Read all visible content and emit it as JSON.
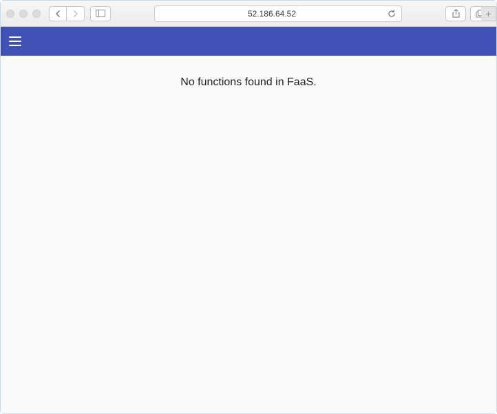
{
  "browser": {
    "address": "52.186.64.52"
  },
  "app": {
    "empty_message": "No functions found in FaaS."
  }
}
